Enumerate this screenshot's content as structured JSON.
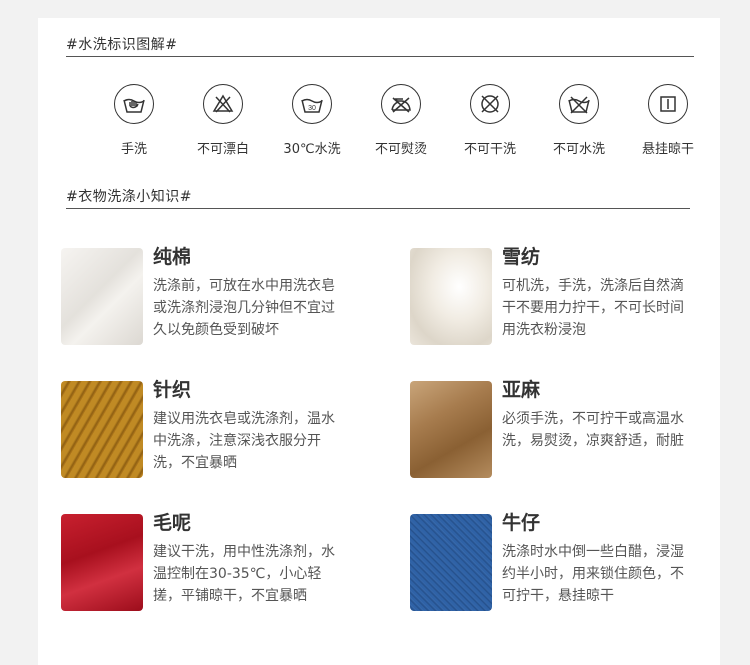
{
  "section1": {
    "title": "#水洗标识图解#"
  },
  "icons": [
    {
      "name": "hand-wash-icon",
      "label": "手洗"
    },
    {
      "name": "no-bleach-icon",
      "label": "不可漂白"
    },
    {
      "name": "wash-30-icon",
      "label": "30℃水洗",
      "temp": "30"
    },
    {
      "name": "no-iron-icon",
      "label": "不可熨烫"
    },
    {
      "name": "no-dry-clean-icon",
      "label": "不可干洗"
    },
    {
      "name": "no-water-wash-icon",
      "label": "不可水洗"
    },
    {
      "name": "hang-dry-icon",
      "label": "悬挂晾干"
    }
  ],
  "section2": {
    "title": "#衣物洗涤小知识#"
  },
  "fabrics": [
    {
      "name": "纯棉",
      "desc": "洗涤前，可放在水中用洗衣皂或洗涤剂浸泡几分钟但不宜过久以免颜色受到破坏",
      "color": "#ece9e5"
    },
    {
      "name": "雪纺",
      "desc": "可机洗，手洗，洗涤后自然滴干不要用力拧干，不可长时间用洗衣粉浸泡",
      "color": "#f3f0ea"
    },
    {
      "name": "针织",
      "desc": "建议用洗衣皂或洗涤剂，温水中洗涤，注意深浅衣服分开洗，不宜暴晒",
      "color": "#b9821f"
    },
    {
      "name": "亚麻",
      "desc": "必须手洗，不可拧干或高温水洗，易熨烫，凉爽舒适，耐脏",
      "color": "#a47a4d"
    },
    {
      "name": "毛呢",
      "desc": "建议干洗，用中性洗涤剂，水温控制在30-35℃，小心轻搓，平铺晾干，不宜暴晒",
      "color": "#b51a2a"
    },
    {
      "name": "牛仔",
      "desc": "洗涤时水中倒一些白醋，浸湿约半小时，用来锁住颜色，不可拧干，悬挂晾干",
      "color": "#2c5a9a"
    }
  ]
}
